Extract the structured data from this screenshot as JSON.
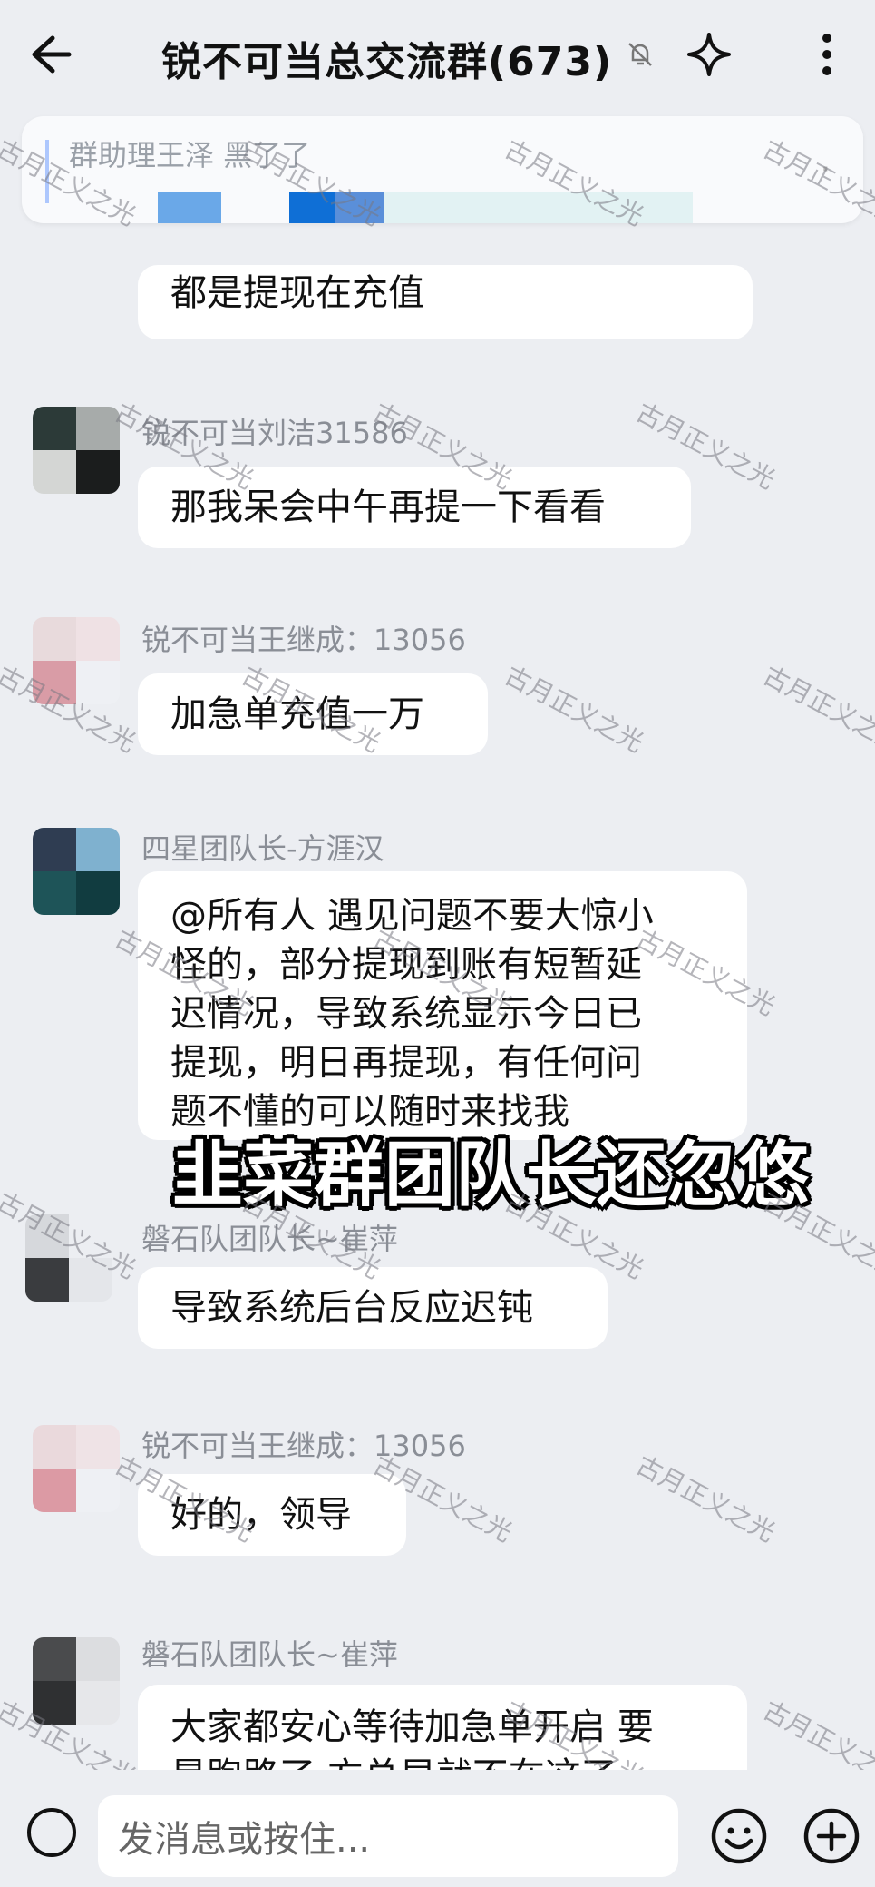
{
  "header": {
    "title": "锐不可当总交流群(673)",
    "back_icon": "arrow-left-icon",
    "mute_icon": "bell-off-icon",
    "sparkle_icon": "sparkle-icon",
    "more_icon": "more-vertical-icon"
  },
  "pinned": {
    "text": "群助理王泽 黑了了",
    "close_icon": "close-icon"
  },
  "messages": [
    {
      "sender": "",
      "text": "都是提现在充值"
    },
    {
      "sender": "锐不可当刘洁31586",
      "text": "那我呆会中午再提一下看看"
    },
    {
      "sender": "锐不可当王继成：13056",
      "text": "加急单充值一万"
    },
    {
      "sender": "四星团队长-方涯汉",
      "lines": [
        "@所有人 遇见问题不要大惊小",
        "怪的，部分提现到账有短暂延",
        "迟情况，导致系统显示今日已",
        "提现，明日再提现，有任何问",
        "题不懂的可以随时来找我"
      ]
    },
    {
      "sender": "磐石队团队长~崔萍",
      "text": "导致系统后台反应迟钝"
    },
    {
      "sender": "锐不可当王继成：13056",
      "text": "好的，领导"
    },
    {
      "sender": "磐石队团队长~崔萍",
      "lines": [
        "大家都安心等待加急单开启 要",
        "是跑路了 方总早就不在这了"
      ]
    }
  ],
  "overlay_caption": "韭菜群团队长还忽悠",
  "watermark": "古月正义之光",
  "composer": {
    "placeholder": "发消息或按住...",
    "voice_icon": "voice-icon",
    "emoji_icon": "emoji-icon",
    "plus_icon": "plus-icon"
  },
  "colors": {
    "background": "#eceef2",
    "bubble": "#ffffff",
    "sender_text": "#8a8e96"
  }
}
